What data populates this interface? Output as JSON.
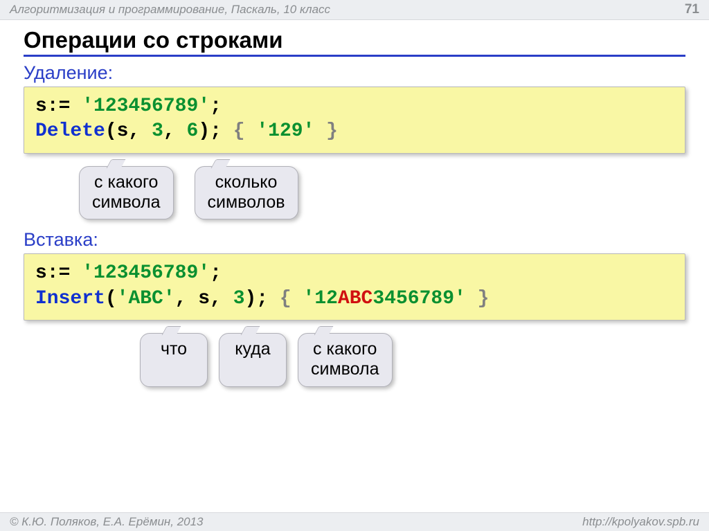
{
  "header": {
    "course": "Алгоритмизация и программирование, Паскаль, 10 класс",
    "page": "71"
  },
  "title": "Операции со строками",
  "sec1": {
    "heading": "Удаление:",
    "code": {
      "l1a": "s:= ",
      "l1b": "'123456789'",
      "l1c": ";",
      "l2a": "Delete",
      "l2b": "(s,",
      "l2c": "3",
      "l2d": ",",
      "l2e": "6",
      "l2f": "); ",
      "l2g": "{ ",
      "l2h": "'129'",
      "l2i": " }"
    },
    "tip1": "с какого\nсимвола",
    "tip2": "сколько\nсимволов"
  },
  "sec2": {
    "heading": "Вставка:",
    "code": {
      "l1a": "s:= ",
      "l1b": "'123456789'",
      "l1c": ";",
      "l2a": "Insert",
      "l2b": "(",
      "l2c": "'ABC'",
      "l2d": ", s,",
      "l2e": "3",
      "l2f": "); ",
      "l2g": "{ ",
      "l2h1": "'12",
      "l2h2": "ABC",
      "l2h3": "3456789'",
      "l2i": " }"
    },
    "tip1": "что",
    "tip2": "куда",
    "tip3": "с какого\nсимвола"
  },
  "footer": {
    "left": "© К.Ю. Поляков, Е.А. Ерёмин, 2013",
    "right": "http://kpolyakov.spb.ru"
  }
}
